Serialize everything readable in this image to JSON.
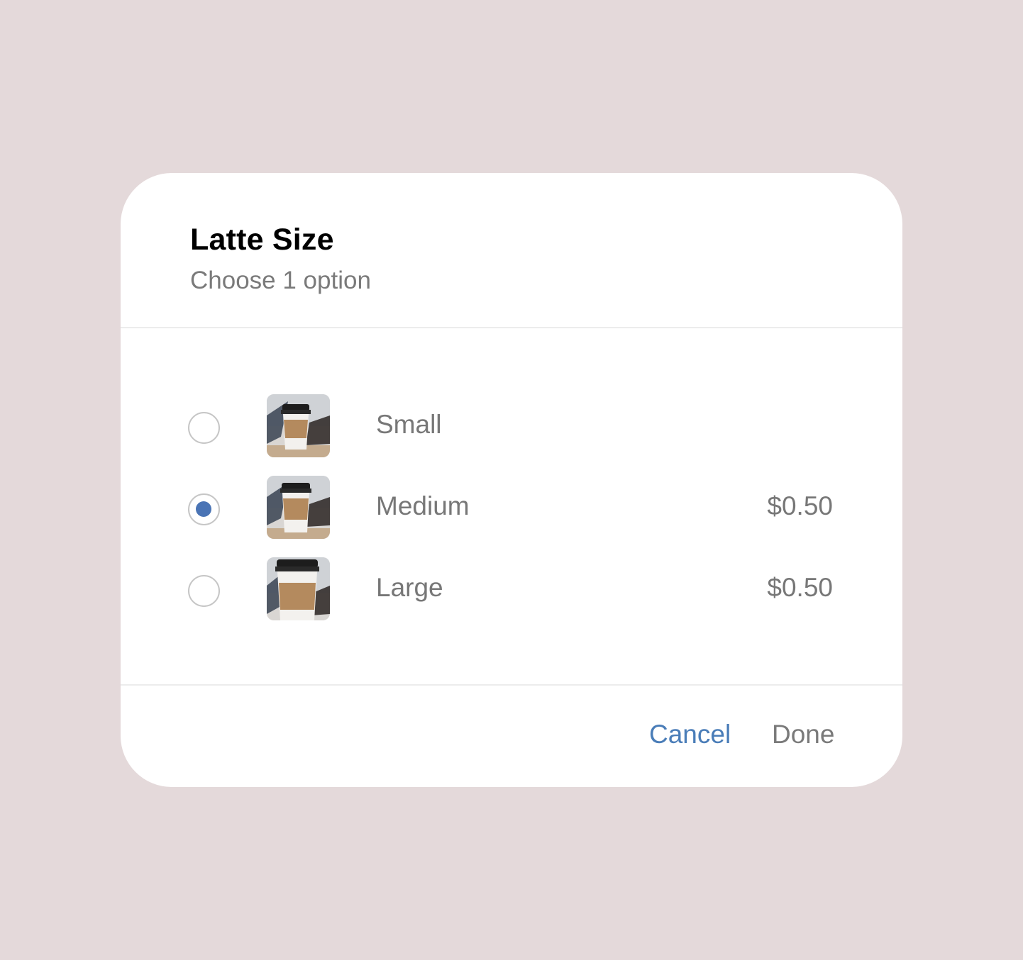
{
  "dialog": {
    "title": "Latte Size",
    "subtitle": "Choose 1 option"
  },
  "options": [
    {
      "label": "Small",
      "price": "",
      "selected": false,
      "icon": "coffee-cup-image"
    },
    {
      "label": "Medium",
      "price": "$0.50",
      "selected": true,
      "icon": "coffee-cup-image"
    },
    {
      "label": "Large",
      "price": "$0.50",
      "selected": false,
      "icon": "coffee-cup-image"
    }
  ],
  "footer": {
    "cancel_label": "Cancel",
    "done_label": "Done"
  },
  "colors": {
    "background": "#e4d9da",
    "accent": "#4a74b5",
    "link": "#4a7db8",
    "muted_text": "#777777"
  }
}
